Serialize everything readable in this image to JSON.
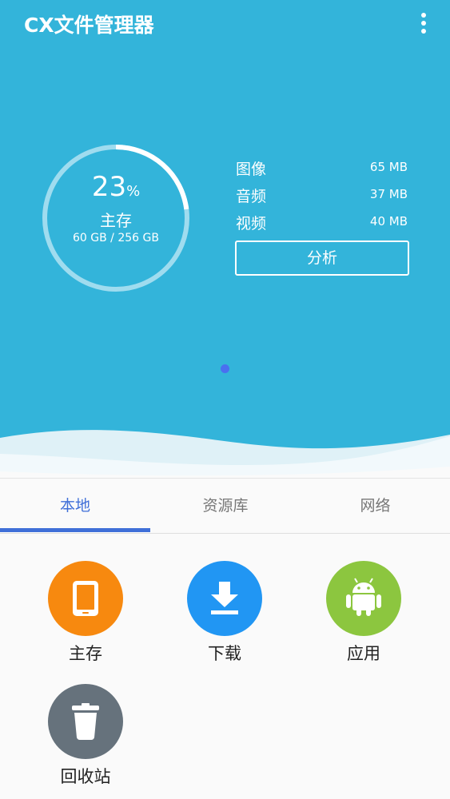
{
  "app": {
    "title": "CX文件管理器"
  },
  "storage": {
    "percent": "23",
    "percent_sign": "%",
    "name": "主存",
    "capacity": "60 GB / 256 GB",
    "used_fraction": 0.23
  },
  "stats": [
    {
      "label": "图像",
      "value": "65 MB"
    },
    {
      "label": "音频",
      "value": "37 MB"
    },
    {
      "label": "视频",
      "value": "40 MB"
    }
  ],
  "analyze_button": "分析",
  "tabs": [
    {
      "label": "本地",
      "active": true
    },
    {
      "label": "资源库",
      "active": false
    },
    {
      "label": "网络",
      "active": false
    }
  ],
  "shortcuts": [
    {
      "label": "主存",
      "icon": "phone-icon",
      "color": "#f7890f"
    },
    {
      "label": "下载",
      "icon": "download-icon",
      "color": "#2196f3"
    },
    {
      "label": "应用",
      "icon": "android-icon",
      "color": "#8cc63f"
    },
    {
      "label": "回收站",
      "icon": "trash-icon",
      "color": "#66727c"
    }
  ],
  "colors": {
    "hero_background": "#33b4da",
    "accent": "#3f6fd8",
    "page_indicator": "#4a6ff0"
  }
}
